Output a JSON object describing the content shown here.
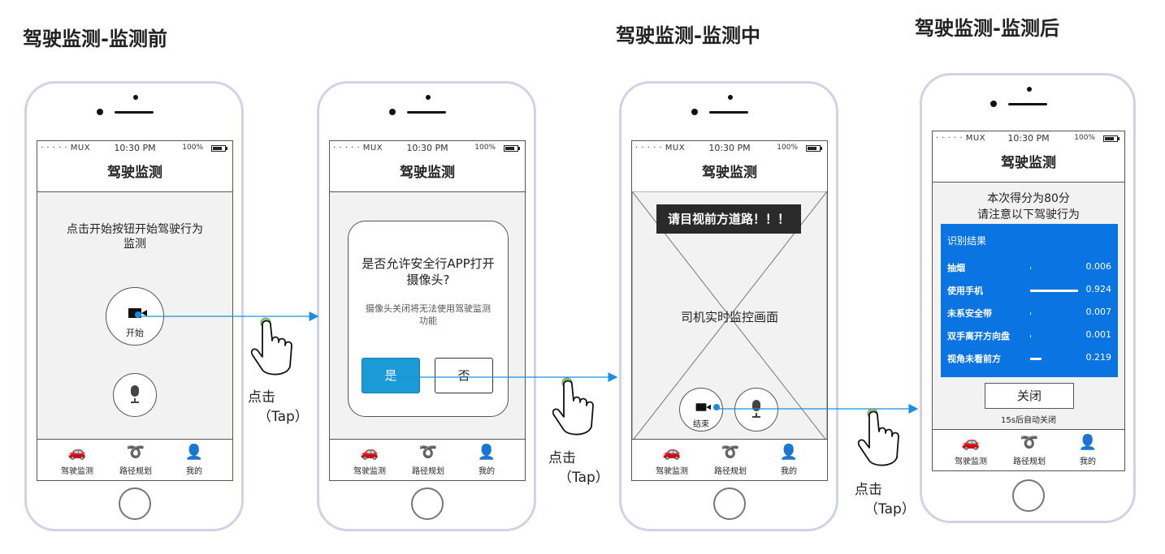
{
  "stages": {
    "before": "驾驶监测-监测前",
    "during": "驾驶监测-监测中",
    "after": "驾驶监测-监测后"
  },
  "status": {
    "carrier": "· · · · ·  MUX",
    "time": "10:30 PM",
    "battery": "100%"
  },
  "nav_title": "驾驶监测",
  "tabs": [
    {
      "label": "驾驶监测",
      "icon": "car-icon"
    },
    {
      "label": "路径规划",
      "icon": "route-icon"
    },
    {
      "label": "我的",
      "icon": "user-icon"
    }
  ],
  "screen1": {
    "prompt": "点击开始按钮开始驾驶行为监测",
    "start_label": "开始"
  },
  "screen2": {
    "dialog_title": "是否允许安全行APP打开摄像头?",
    "dialog_sub": "摄像头关闭将无法使用驾驶监测功能",
    "yes": "是",
    "no": "否"
  },
  "screen3": {
    "warning": "请目视前方道路！！！",
    "video_label": "司机实时监控画面",
    "end_label": "结束"
  },
  "screen4": {
    "score_line": "本次得分为80分",
    "notice_line": "请注意以下驾驶行为",
    "result_title": "识别结果",
    "results": [
      {
        "label": "抽烟",
        "value": "0.006",
        "fraction": 0.006
      },
      {
        "label": "使用手机",
        "value": "0.924",
        "fraction": 0.924
      },
      {
        "label": "未系安全带",
        "value": "0.007",
        "fraction": 0.007
      },
      {
        "label": "双手离开方向盘",
        "value": "0.001",
        "fraction": 0.001
      },
      {
        "label": "视角未看前方",
        "value": "0.219",
        "fraction": 0.219
      }
    ],
    "close": "关闭",
    "auto_close": "15s后自动关闭"
  },
  "tap": {
    "line1": "点击",
    "line2": "（Tap）"
  },
  "colors": {
    "accent_blue": "#1a9ad6",
    "panel_blue": "#0a74e2",
    "arrow": "#1a8fe0",
    "phone_frame": "#cfd3e4"
  }
}
